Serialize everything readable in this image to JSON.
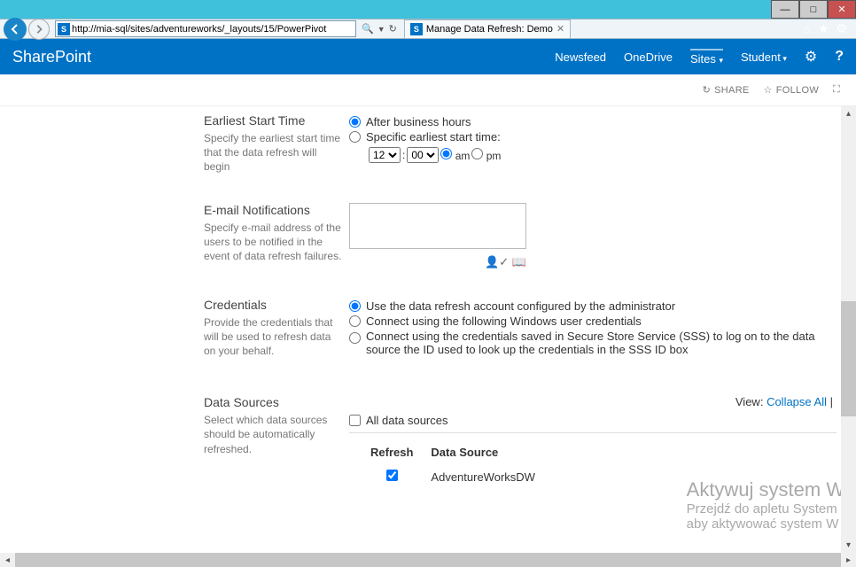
{
  "window": {
    "url": "http://mia-sql/sites/adventureworks/_layouts/15/PowerPivot",
    "tab_title": "Manage Data Refresh: Demo"
  },
  "sp": {
    "brand": "SharePoint",
    "nav": {
      "newsfeed": "Newsfeed",
      "onedrive": "OneDrive",
      "sites": "Sites",
      "user": "Student"
    },
    "actions": {
      "share": "SHARE",
      "follow": "FOLLOW"
    }
  },
  "sections": {
    "earliest": {
      "title": "Earliest Start Time",
      "desc": "Specify the earliest start time that the data refresh will begin",
      "opt_after": "After business hours",
      "opt_specific": "Specific earliest start time:",
      "hour": "12",
      "minute": "00",
      "am": "am",
      "pm": "pm"
    },
    "email": {
      "title": "E-mail Notifications",
      "desc": "Specify e-mail address of the users to be notified in the event of data refresh failures."
    },
    "creds": {
      "title": "Credentials",
      "desc": "Provide the credentials that will be used to refresh data on your behalf.",
      "opt_admin": "Use the data refresh account configured by the administrator",
      "opt_windows": "Connect using the following Windows user credentials",
      "opt_sss": "Connect using the credentials saved in Secure Store Service (SSS) to log on to the data source the ID used to look up the credentials in the SSS ID box"
    },
    "datasources": {
      "title": "Data Sources",
      "desc": "Select which data sources should be automatically refreshed.",
      "view_label": "View:",
      "collapse": "Collapse All",
      "alldata": "All data sources",
      "col_refresh": "Refresh",
      "col_source": "Data Source",
      "rows": [
        {
          "name": "AdventureWorksDW",
          "checked": true
        }
      ]
    }
  },
  "watermark": {
    "line1": "Aktywuj system Wi",
    "line2": "Przejdź do apletu System",
    "line3": "aby aktywować system W"
  }
}
